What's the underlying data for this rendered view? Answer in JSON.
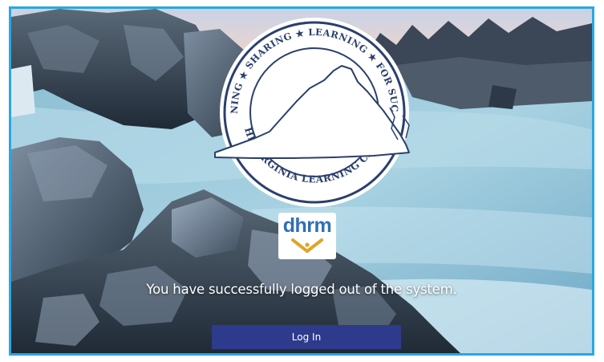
{
  "seal": {
    "top_text": "TRAINING ★ SHARING ★ LEARNING ★ FOR SUCCESS",
    "bottom_text": "THE VIRGINIA LEARNING CENTER"
  },
  "brand": {
    "dhrm_label": "dhrm",
    "dhrm_color": "#2f6fb7",
    "chevron_color": "#e0a526"
  },
  "logout": {
    "message": "You have successfully logged out of the system.",
    "login_label": "Log In",
    "button_color": "#2e3a8c",
    "frame_color": "#29a8e0"
  }
}
